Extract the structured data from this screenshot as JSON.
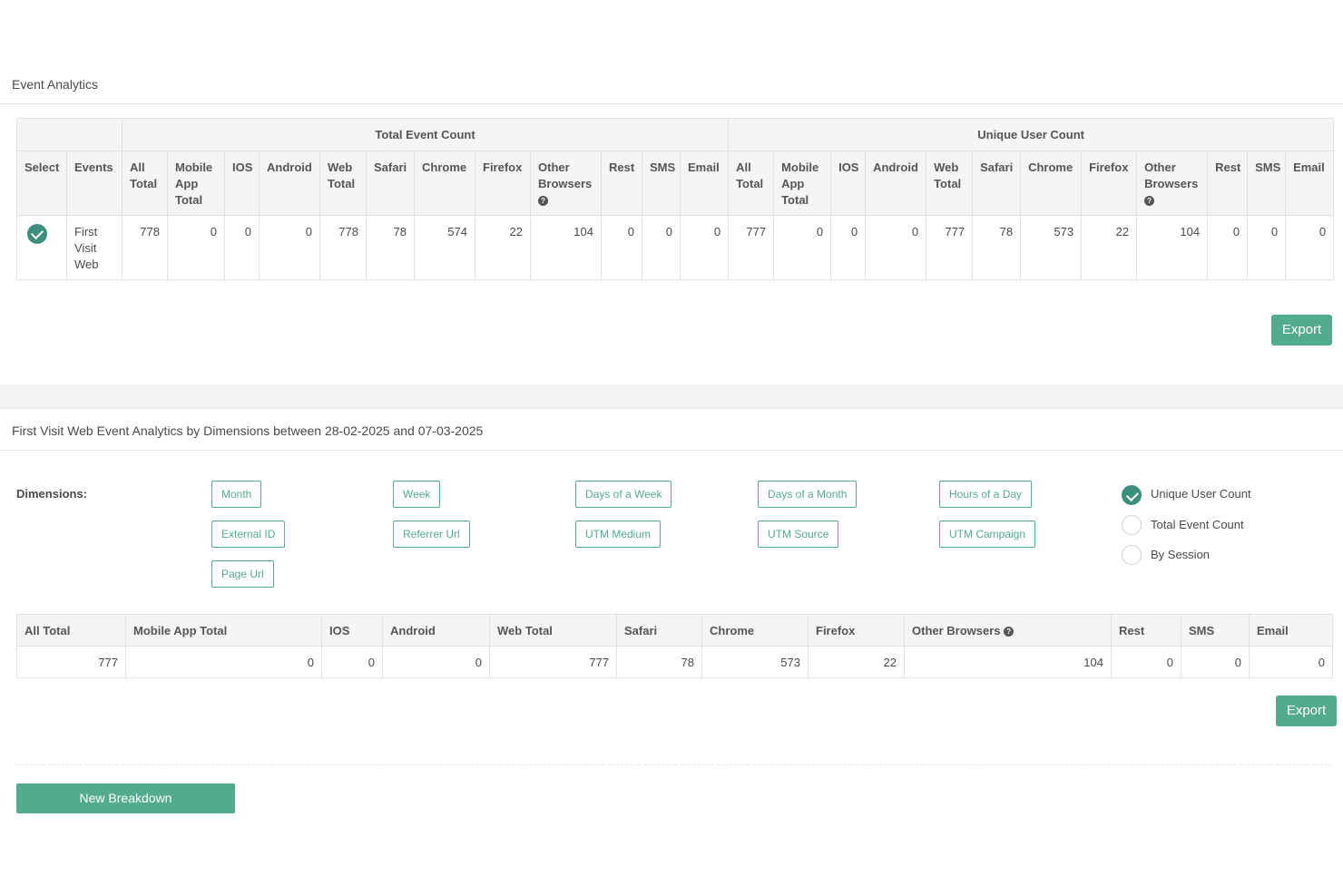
{
  "event_analytics": {
    "title": "Event Analytics",
    "group_headers": {
      "total": "Total Event Count",
      "unique": "Unique User Count"
    },
    "columns": {
      "select": "Select",
      "events": "Events",
      "sub": [
        "All Total",
        "Mobile App Total",
        "IOS",
        "Android",
        "Web Total",
        "Safari",
        "Chrome",
        "Firefox",
        "Other Browsers",
        "Rest",
        "SMS",
        "Email"
      ]
    },
    "row": {
      "event": "First Visit Web",
      "total": [
        "778",
        "0",
        "0",
        "0",
        "778",
        "78",
        "574",
        "22",
        "104",
        "0",
        "0",
        "0"
      ],
      "unique": [
        "777",
        "0",
        "0",
        "0",
        "777",
        "78",
        "573",
        "22",
        "104",
        "0",
        "0",
        "0"
      ]
    },
    "export_label": "Export"
  },
  "dimensions_section": {
    "title": "First Visit Web Event Analytics by Dimensions between 28-02-2025 and 07-03-2025",
    "dimensions_label": "Dimensions:",
    "chips": [
      "Month",
      "Week",
      "Days of a Week",
      "Days of a Month",
      "Hours of a Day",
      "External ID",
      "Referrer Url",
      "UTM Medium",
      "UTM Source",
      "UTM Campaign",
      "Page Url"
    ],
    "count_options": [
      {
        "label": "Unique User Count",
        "selected": true
      },
      {
        "label": "Total Event Count",
        "selected": false
      },
      {
        "label": "By Session",
        "selected": false
      }
    ],
    "table": {
      "headers": [
        "All Total",
        "Mobile App Total",
        "IOS",
        "Android",
        "Web Total",
        "Safari",
        "Chrome",
        "Firefox",
        "Other Browsers",
        "Rest",
        "SMS",
        "Email"
      ],
      "values": [
        "777",
        "0",
        "0",
        "0",
        "777",
        "78",
        "573",
        "22",
        "104",
        "0",
        "0",
        "0"
      ]
    },
    "export_label": "Export",
    "new_breakdown_label": "New Breakdown"
  },
  "icons": {
    "help": "question-circle-icon",
    "selected": "check-circle-icon"
  },
  "colors": {
    "accent": "#53ab8f",
    "check": "#3c8f7c"
  }
}
